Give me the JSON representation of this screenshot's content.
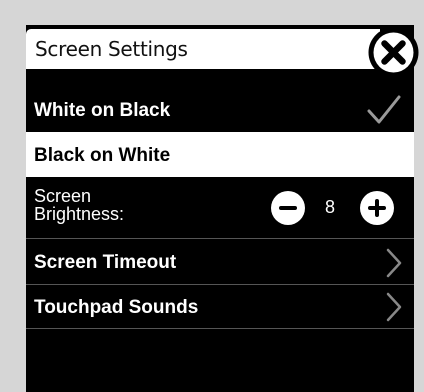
{
  "header": {
    "title": "Screen Settings"
  },
  "settings": {
    "white_on_black": {
      "label": "White on Black",
      "selected": true
    },
    "black_on_white": {
      "label": "Black on White",
      "selected": false
    },
    "brightness": {
      "label": "Screen Brightness:",
      "value": "8"
    },
    "timeout": {
      "label": "Screen Timeout"
    },
    "touchpad": {
      "label": "Touchpad Sounds"
    }
  },
  "icons": {
    "close": "close-icon",
    "check": "checkmark-icon",
    "minus": "minus-icon",
    "plus": "plus-icon",
    "chevron": "chevron-right-icon"
  },
  "colors": {
    "background": "#d6d6d6",
    "panel": "#000000",
    "highlight": "#ffffff"
  }
}
